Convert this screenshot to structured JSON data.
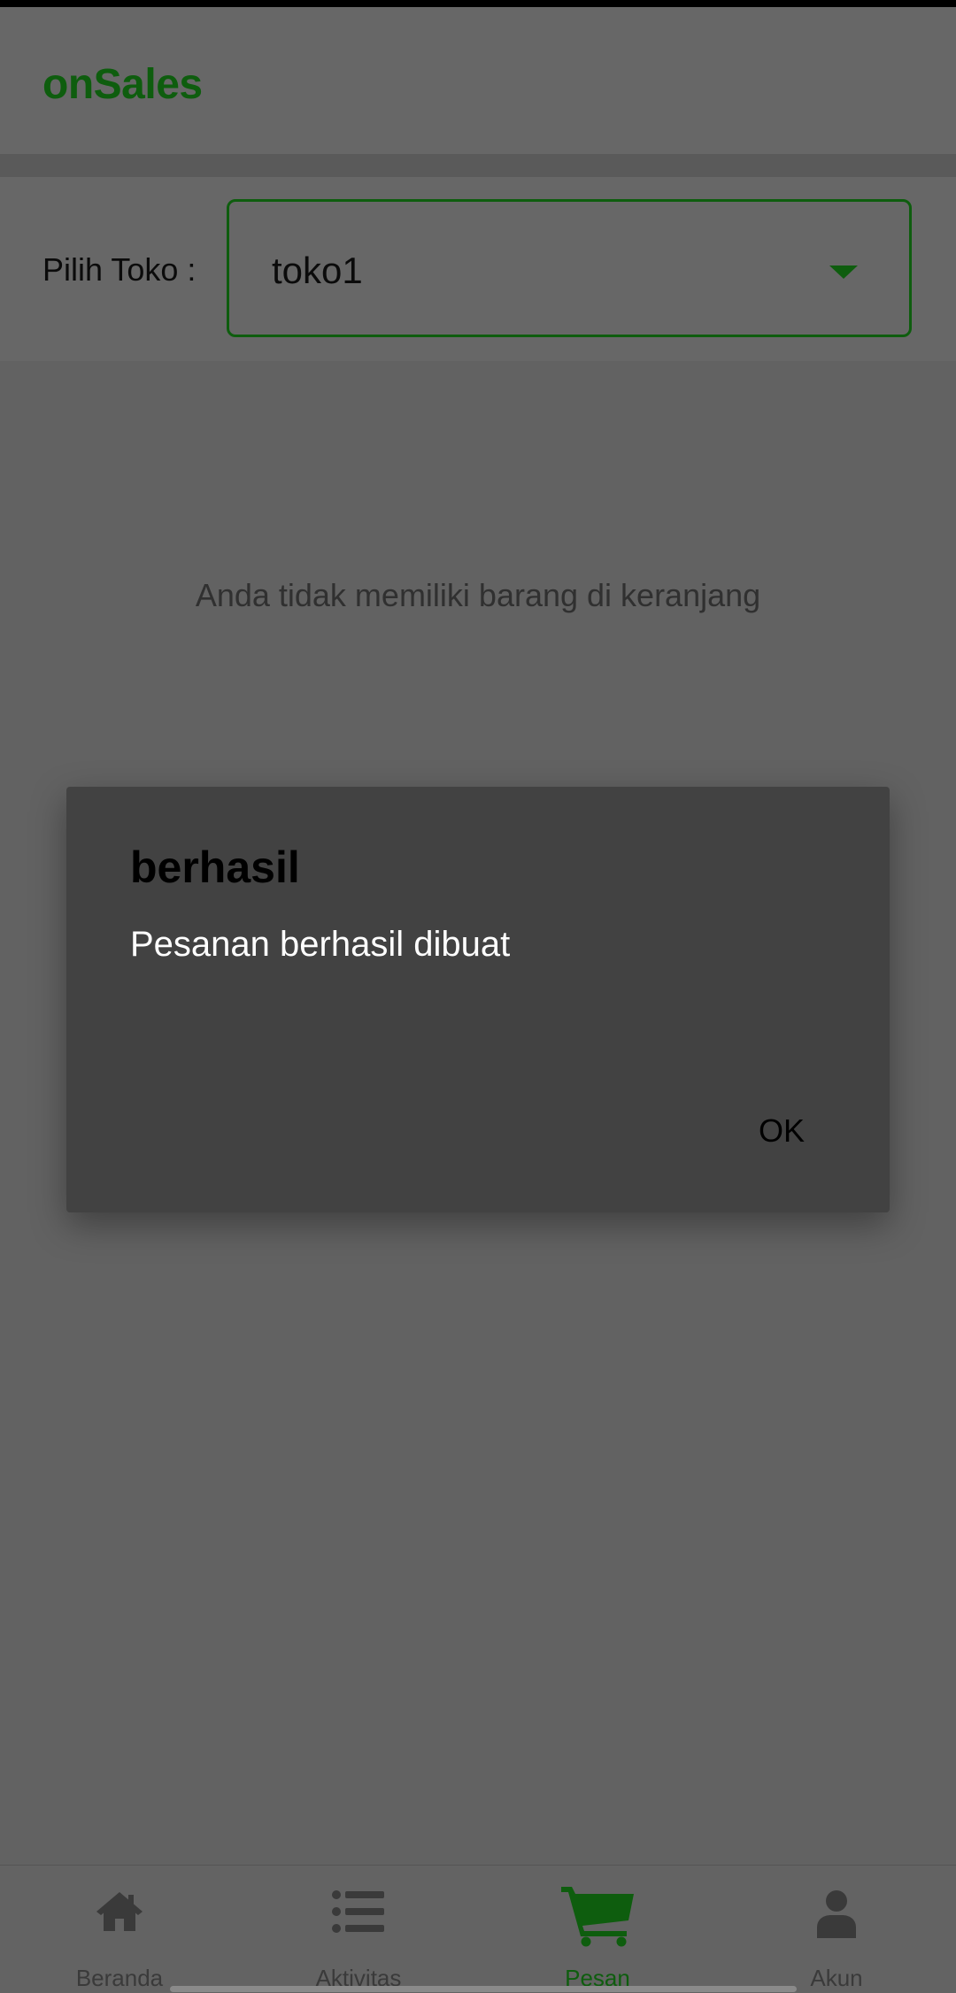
{
  "header": {
    "app_title": "onSales"
  },
  "store_picker": {
    "label": "Pilih Toko :",
    "selected": "toko1"
  },
  "cart": {
    "empty_message": "Anda tidak memiliki barang di keranjang"
  },
  "dialog": {
    "title": "berhasil",
    "message": "Pesanan berhasil dibuat",
    "ok_label": "OK"
  },
  "bottom_nav": {
    "items": [
      {
        "label": "Beranda",
        "icon": "home-icon"
      },
      {
        "label": "Aktivitas",
        "icon": "list-icon"
      },
      {
        "label": "Pesan",
        "icon": "cart-icon",
        "active": true
      },
      {
        "label": "Akun",
        "icon": "user-icon"
      }
    ]
  },
  "colors": {
    "brand_green": "#0e5d0e",
    "overlay_background": "#626262",
    "dialog_background": "#424242"
  }
}
